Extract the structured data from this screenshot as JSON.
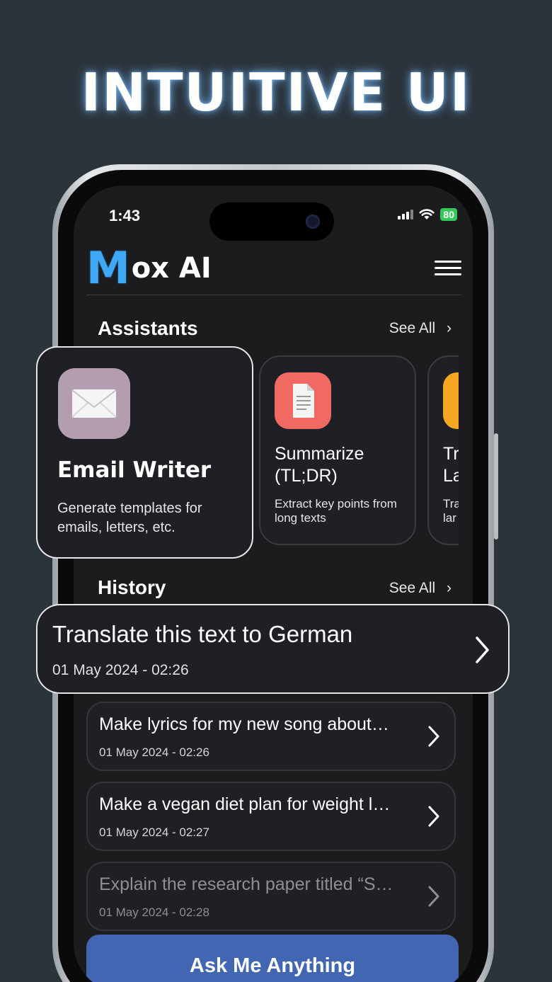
{
  "headline": "INTUITIVE UI",
  "status": {
    "time": "1:43",
    "battery": "80"
  },
  "app": {
    "logo_m": "M",
    "logo_rest": "ox AI"
  },
  "assistants": {
    "title": "Assistants",
    "see_all": "See All",
    "cards": [
      {
        "title": "Email Writer",
        "desc": "Generate templates for emails, letters, etc.",
        "icon": "envelope-icon",
        "icon_bg": "#b39eb0"
      },
      {
        "title": "Summarize (TL;DR)",
        "desc": "Extract key points from long texts",
        "icon": "document-icon",
        "icon_bg": "#f06a63"
      },
      {
        "title": "Tr La",
        "desc": "Tra lar",
        "icon": "translate-icon",
        "icon_bg": "#f5a623"
      }
    ]
  },
  "history": {
    "title": "History",
    "see_all": "See All",
    "items": [
      {
        "title": "Translate this text to German",
        "date": "01 May 2024 - 02:26"
      },
      {
        "title": "Make lyrics for my new song about…",
        "date": "01 May 2024 - 02:26"
      },
      {
        "title": "Make a vegan diet plan for weight l…",
        "date": "01 May 2024 - 02:27"
      },
      {
        "title": "Explain the research paper titled “S…",
        "date": "01 May 2024 - 02:28"
      }
    ]
  },
  "ask_button": "Ask Me Anything",
  "colors": {
    "background": "#2b333b",
    "accent": "#4366b3",
    "logo_blue": "#3fa9f5",
    "battery_green": "#34c759"
  }
}
